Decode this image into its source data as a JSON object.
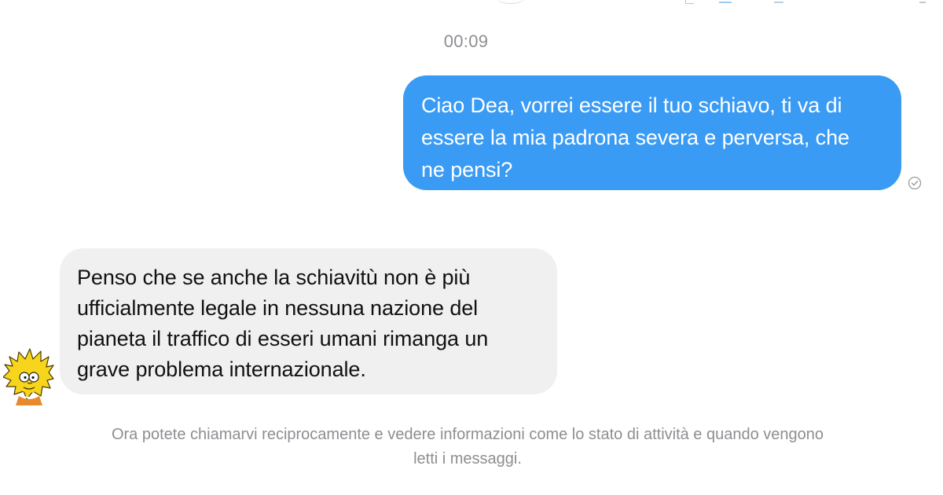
{
  "conversation": {
    "timestamp": "00:09",
    "outgoing_message": {
      "lines": [
        "Ciao Dea, vorrei essere il tuo schiavo, ti va di",
        "essere la mia padrona severa e perversa, che",
        "ne pensi?"
      ],
      "status_icon": "seen-check-icon"
    },
    "incoming_message": {
      "lines": [
        "Penso che se anche la schiavitù non è più",
        "ufficialmente legale in nessuna nazione del",
        "pianeta il traffico di esseri umani rimanga un",
        "grave problema internazionale."
      ],
      "avatar_icon": "cartoon-character-avatar"
    },
    "system_notice": {
      "lines": [
        "Ora potete chiamarvi reciprocamente e vedere informazioni come lo stato di attività e quando vengono",
        "letti i messaggi."
      ]
    }
  },
  "colors": {
    "outgoing_bubble": "#3a9bf5",
    "incoming_bubble": "#f0f0f0",
    "muted_text": "#8e8e93",
    "avatar_yellow": "#f7d51d"
  }
}
